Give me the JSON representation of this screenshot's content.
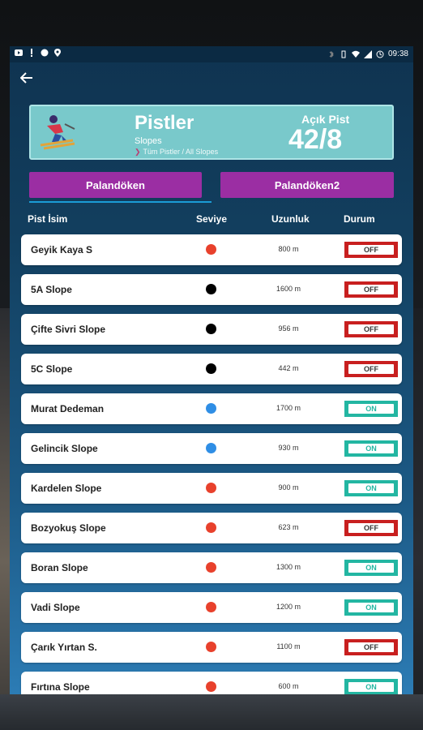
{
  "statusbar": {
    "time": "09:38"
  },
  "header": {
    "title": "Pistler",
    "subtitle": "Slopes",
    "breadcrumb": "Tüm Pistler / All Slopes",
    "open_label": "Açık Pist",
    "open_count": "42/8"
  },
  "tabs": [
    {
      "label": "Palandöken"
    },
    {
      "label": "Palandöken2"
    }
  ],
  "table": {
    "headers": {
      "name": "Pist İsim",
      "level": "Seviye",
      "length": "Uzunluk",
      "state": "Durum"
    },
    "rows": [
      {
        "name": "Geyik Kaya S",
        "level": "red",
        "length": "800 m",
        "state": "OFF"
      },
      {
        "name": "5A Slope",
        "level": "black",
        "length": "1600 m",
        "state": "OFF"
      },
      {
        "name": "Çifte Sivri Slope",
        "level": "black",
        "length": "956 m",
        "state": "OFF"
      },
      {
        "name": "5C Slope",
        "level": "black",
        "length": "442 m",
        "state": "OFF"
      },
      {
        "name": "Murat Dedeman",
        "level": "blue",
        "length": "1700 m",
        "state": "ON"
      },
      {
        "name": "Gelincik Slope",
        "level": "blue",
        "length": "930 m",
        "state": "ON"
      },
      {
        "name": "Kardelen Slope",
        "level": "red",
        "length": "900 m",
        "state": "ON"
      },
      {
        "name": "Bozyokuş Slope",
        "level": "red",
        "length": "623 m",
        "state": "OFF"
      },
      {
        "name": "Boran Slope",
        "level": "red",
        "length": "1300 m",
        "state": "ON"
      },
      {
        "name": "Vadi Slope",
        "level": "red",
        "length": "1200 m",
        "state": "ON"
      },
      {
        "name": "Çarık Yırtan S.",
        "level": "red",
        "length": "1100 m",
        "state": "OFF"
      },
      {
        "name": "Fırtına Slope",
        "level": "red",
        "length": "600 m",
        "state": "ON"
      }
    ]
  },
  "colors": {
    "level_red": "#e8412c",
    "level_black": "#000000",
    "level_blue": "#2f8ee5",
    "status_on": "#23b6a2",
    "status_off": "#c81f1f",
    "tab": "#9b2ea3",
    "header_card": "#79c9cb"
  }
}
